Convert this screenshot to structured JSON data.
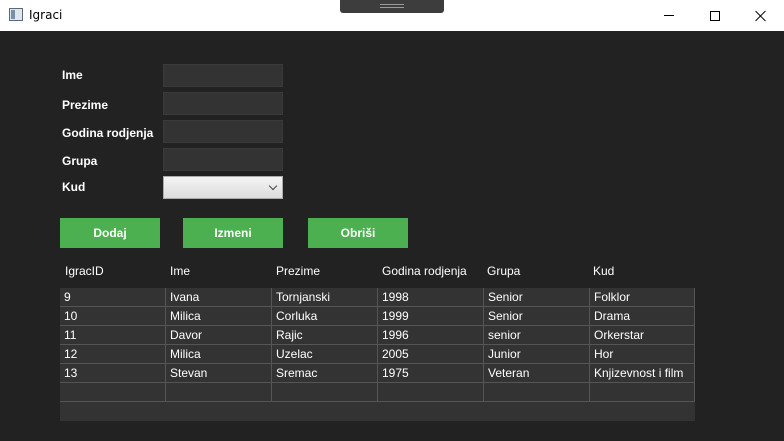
{
  "window": {
    "title": "Igraci"
  },
  "form": {
    "labels": [
      "Ime",
      "Prezime",
      "Godina rodjenja",
      "Grupa",
      "Kud"
    ],
    "values": [
      "",
      "",
      "",
      ""
    ],
    "kud_selected": ""
  },
  "buttons": {
    "add": "Dodaj",
    "edit": "Izmeni",
    "delete": "Obriši"
  },
  "grid": {
    "columns": [
      "IgracID",
      "Ime",
      "Prezime",
      "Godina rodjenja",
      "Grupa",
      "Kud"
    ],
    "rows": [
      [
        "9",
        "Ivana",
        "Tornjanski",
        "1998",
        "Senior",
        "Folklor"
      ],
      [
        "10",
        "Milica",
        "Corluka",
        "1999",
        "Senior",
        "Drama"
      ],
      [
        "11",
        "Davor",
        "Rajic",
        "1996",
        "senior",
        "Orkerstar"
      ],
      [
        "12",
        "Milica",
        "Uzelac",
        "2005",
        "Junior",
        "Hor"
      ],
      [
        "13",
        "Stevan",
        "Sremac",
        "1975",
        "Veteran",
        "Knjizevnost i film"
      ]
    ]
  },
  "colors": {
    "background": "#222222",
    "accent": "#4caf50",
    "row_bg": "#333333"
  }
}
